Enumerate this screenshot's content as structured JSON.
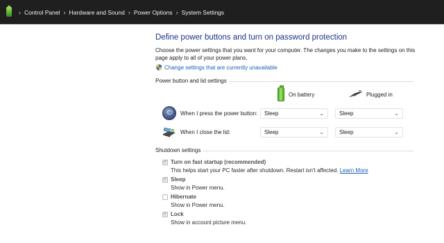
{
  "breadcrumb": [
    "Control Panel",
    "Hardware and Sound",
    "Power Options",
    "System Settings"
  ],
  "breadcrumb_separator": "›",
  "heading": "Define power buttons and turn on password protection",
  "description": "Choose the power settings that you want for your computer. The changes you make to the settings on this page apply to all of your power plans.",
  "change_link": "Change settings that are currently unavailable",
  "power_section": {
    "label": "Power button and lid settings",
    "columns": [
      "On battery",
      "Plugged in"
    ],
    "rows": [
      {
        "label": "When I press the power button:",
        "icon": "power-button-icon",
        "on_battery": "Sleep",
        "plugged_in": "Sleep"
      },
      {
        "label": "When I close the lid:",
        "icon": "laptop-lid-icon",
        "on_battery": "Sleep",
        "plugged_in": "Sleep"
      }
    ]
  },
  "shutdown_section": {
    "label": "Shutdown settings",
    "items": [
      {
        "title": "Turn on fast startup (recommended)",
        "description": "This helps start your PC faster after shutdown. Restart isn't affected.",
        "link": "Learn More",
        "checked": true
      },
      {
        "title": "Sleep",
        "description": "Show in Power menu.",
        "checked": true
      },
      {
        "title": "Hibernate",
        "description": "Show in Power menu.",
        "checked": false
      },
      {
        "title": "Lock",
        "description": "Show in account picture menu.",
        "checked": true
      }
    ]
  },
  "colors": {
    "titlebar": "#1f1f1f",
    "heading": "#1e3287",
    "link": "#1a5fb4",
    "battery_green": "#4aa627"
  },
  "chevron": "⌄"
}
